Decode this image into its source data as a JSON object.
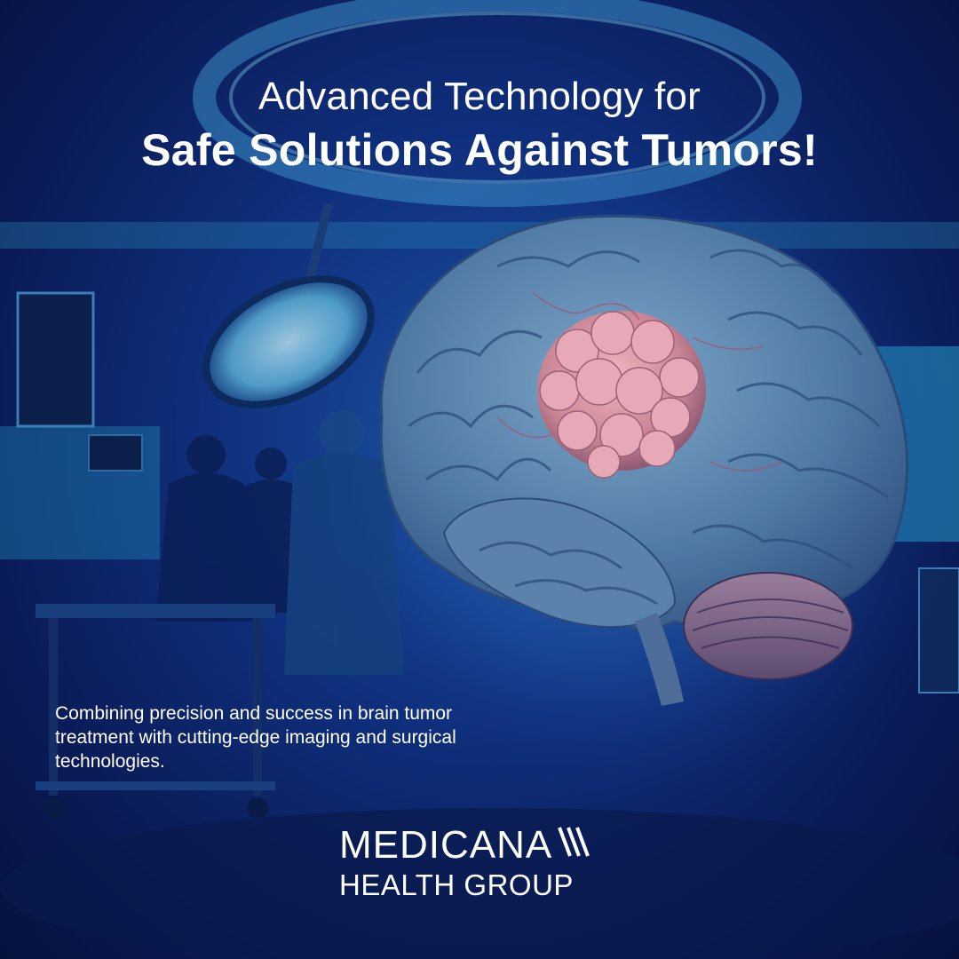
{
  "headline": {
    "line1": "Advanced Technology for",
    "line2": "Safe Solutions Against Tumors!"
  },
  "tagline": "Combining precision and success in brain tumor treatment with cutting-edge imaging and surgical technologies.",
  "logo": {
    "brand": "MEDICANA",
    "group": "HEALTH GROUP"
  },
  "colors": {
    "background": "#0f2f7c",
    "accent": "#2aa9d8",
    "tumor": "#d08a9a",
    "text": "#ffffff"
  },
  "icons": [
    "brain-illustration",
    "surgical-lamp-icon",
    "logo-slashes-icon"
  ]
}
